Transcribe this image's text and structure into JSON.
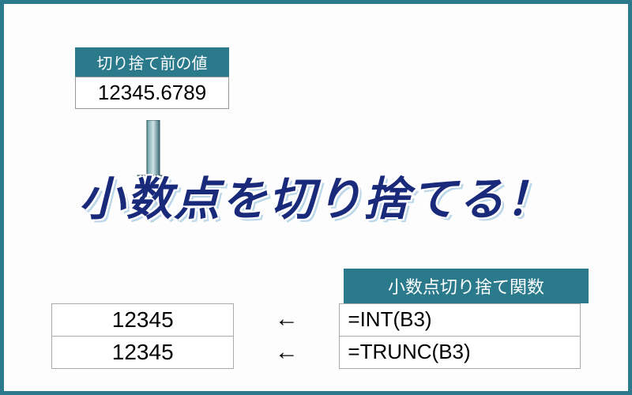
{
  "top": {
    "header": "切り捨て前の値",
    "value": "12345.6789"
  },
  "headline": "小数点を切り捨てる！",
  "funcHeader": "小数点切り捨て関数",
  "rows": [
    {
      "result": "12345",
      "arrow": "←",
      "formula": "=INT(B3)"
    },
    {
      "result": "12345",
      "arrow": "←",
      "formula": "=TRUNC(B3)"
    }
  ],
  "chart_data": {
    "type": "table",
    "title": "小数点を切り捨てる",
    "input_label": "切り捨て前の値",
    "input_value": 12345.6789,
    "functions_label": "小数点切り捨て関数",
    "rows": [
      {
        "result": 12345,
        "formula": "=INT(B3)"
      },
      {
        "result": 12345,
        "formula": "=TRUNC(B3)"
      }
    ]
  }
}
